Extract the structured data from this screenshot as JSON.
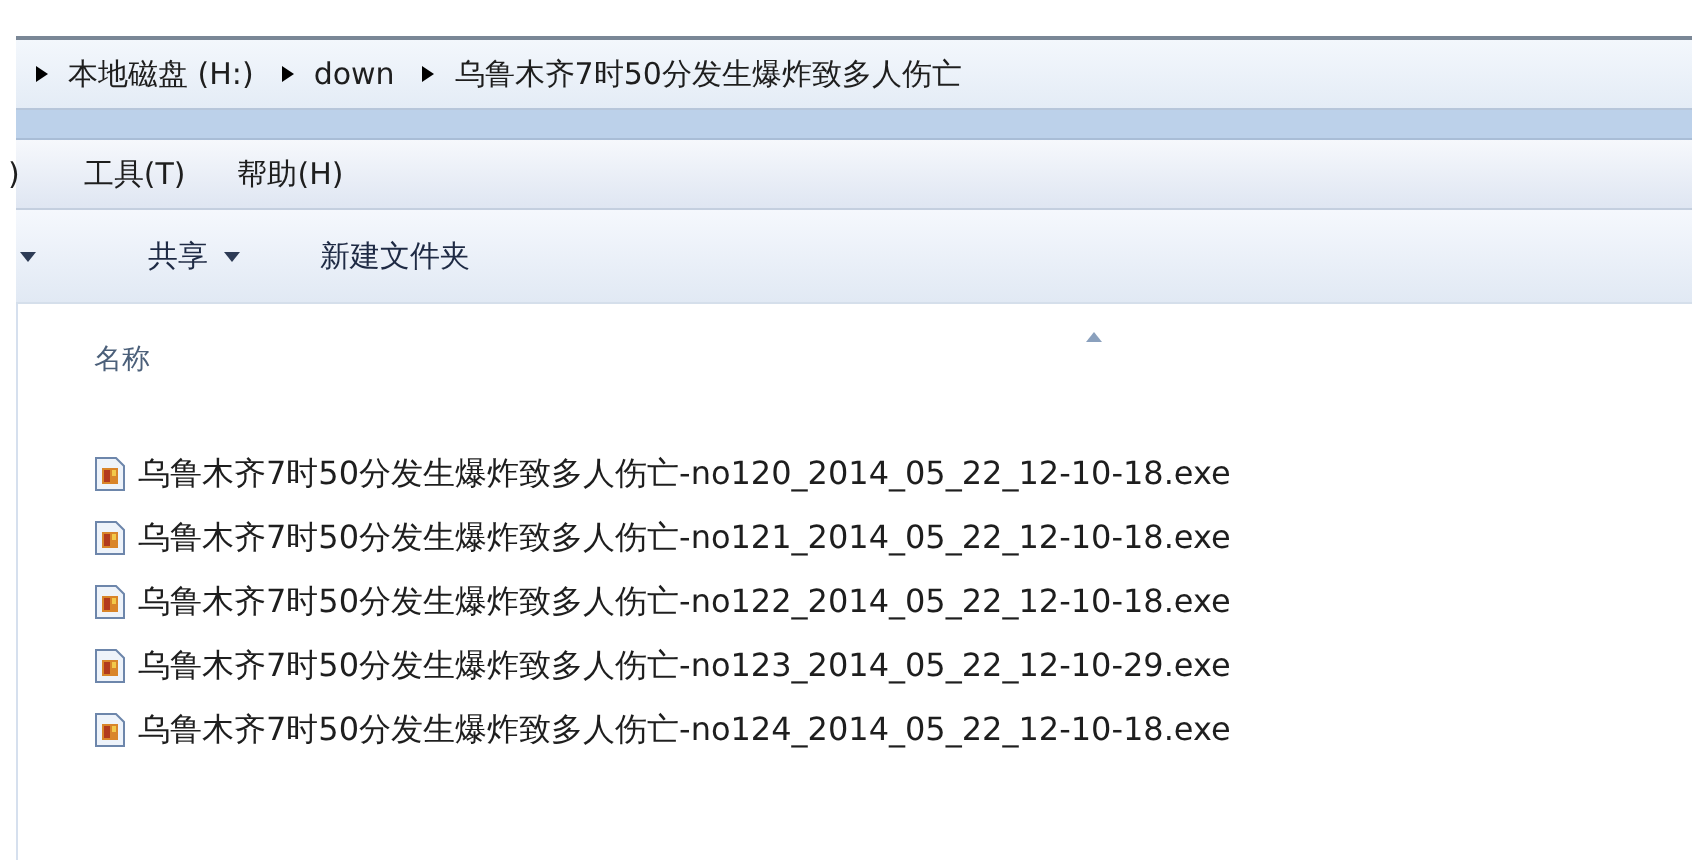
{
  "address_bar": {
    "crumbs": [
      "本地磁盘 (H:)",
      "down",
      "乌鲁木齐7时50分发生爆炸致多人伤亡"
    ]
  },
  "menu_bar": {
    "items": [
      ")",
      "工具(T)",
      "帮助(H)"
    ]
  },
  "toolbar": {
    "items": [
      {
        "kind": "caret"
      },
      {
        "kind": "dropdown",
        "label": "共享"
      },
      {
        "kind": "button",
        "label": "新建文件夹"
      }
    ]
  },
  "file_list": {
    "columns": [
      "名称"
    ],
    "rows": [
      {
        "name": "乌鲁木齐7时50分发生爆炸致多人伤亡-no120_2014_05_22_12-10-18.exe"
      },
      {
        "name": "乌鲁木齐7时50分发生爆炸致多人伤亡-no121_2014_05_22_12-10-18.exe"
      },
      {
        "name": "乌鲁木齐7时50分发生爆炸致多人伤亡-no122_2014_05_22_12-10-18.exe"
      },
      {
        "name": "乌鲁木齐7时50分发生爆炸致多人伤亡-no123_2014_05_22_12-10-29.exe"
      },
      {
        "name": "乌鲁木齐7时50分发生爆炸致多人伤亡-no124_2014_05_22_12-10-18.exe"
      }
    ]
  }
}
